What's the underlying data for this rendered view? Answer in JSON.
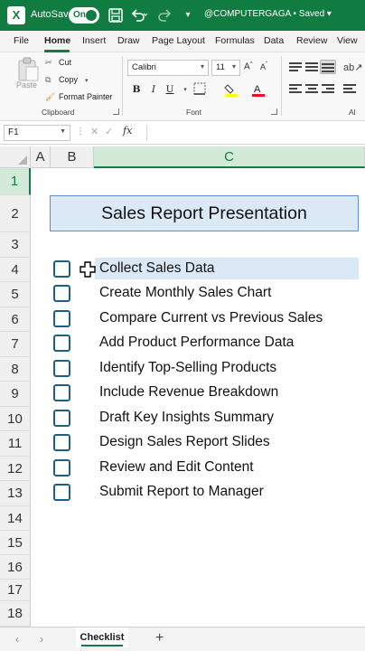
{
  "titlebar": {
    "autosave_label": "AutoSave",
    "autosave_state": "On",
    "doc_title": "@COMPUTERGAGA • Saved ▾",
    "brand_color": "#107c41"
  },
  "ribbon_tabs": [
    "File",
    "Home",
    "Insert",
    "Draw",
    "Page Layout",
    "Formulas",
    "Data",
    "Review",
    "View"
  ],
  "ribbon": {
    "paste_label": "Paste",
    "cut_label": "Cut",
    "copy_label": "Copy",
    "format_painter_label": "Format Painter",
    "clipboard_group": "Clipboard",
    "font_name": "Calibri",
    "font_size": "11",
    "font_group": "Font",
    "alignment_group_partial": "Al"
  },
  "formula_bar": {
    "name_box": "F1",
    "fx": "fx",
    "formula": ""
  },
  "columns": [
    "A",
    "B",
    "C"
  ],
  "rows": [
    "1",
    "2",
    "3",
    "4",
    "5",
    "6",
    "7",
    "8",
    "9",
    "10",
    "11",
    "12",
    "13",
    "14",
    "15",
    "16",
    "17",
    "18"
  ],
  "sheet": {
    "title": "Sales Report Presentation",
    "tasks": [
      "Collect Sales Data",
      "Create Monthly Sales Chart",
      "Compare Current vs Previous Sales",
      "Add Product Performance Data",
      "Identify Top-Selling Products",
      "Include Revenue Breakdown",
      "Draft Key Insights Summary",
      "Design Sales Report Slides",
      "Review and Edit Content",
      "Submit Report to Manager"
    ],
    "checked": [
      false,
      false,
      false,
      false,
      false,
      false,
      false,
      false,
      false,
      false
    ]
  },
  "sheet_tabs": {
    "active": "Checklist",
    "add": "+",
    "prev": "‹",
    "next": "›"
  }
}
